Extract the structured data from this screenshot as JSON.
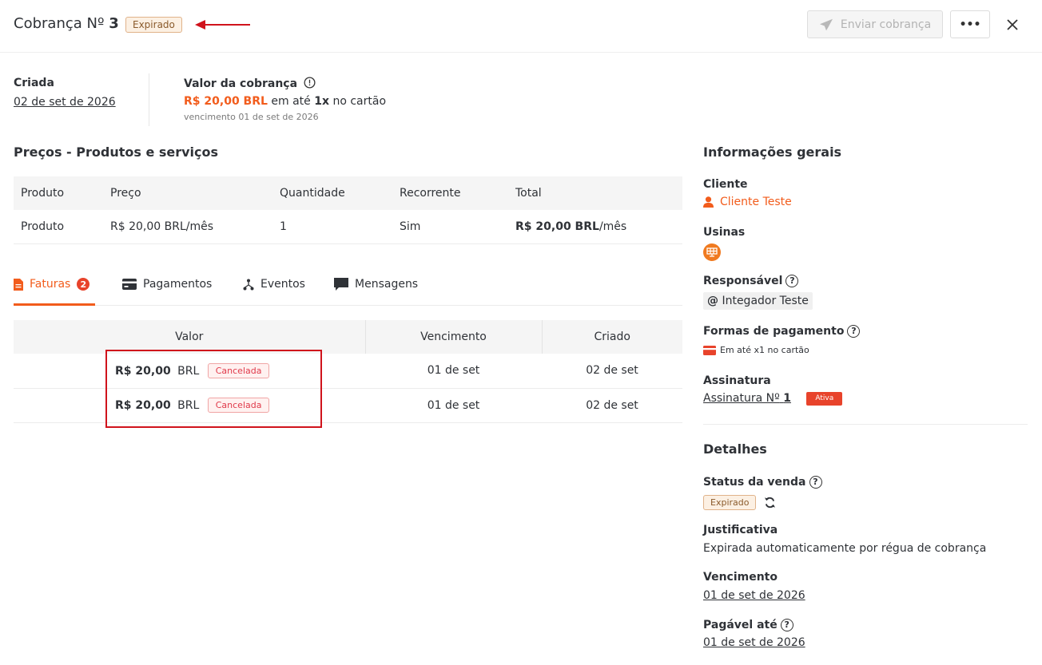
{
  "header": {
    "title_prefix": "Cobrança Nº",
    "title_number": "3",
    "status_badge": "Expirado",
    "send_button": "Enviar cobrança",
    "more_button": "•••",
    "annotation_arrow_color": "#d0131c"
  },
  "summary": {
    "created_label": "Criada",
    "created_date": "02 de set de 2026",
    "amount_label": "Valor da cobrança",
    "amount_value": "R$ 20,00 BRL",
    "amount_text_1": "em até",
    "amount_installments": "1x",
    "amount_text_2": "no cartão",
    "due_note": "vencimento 01 de set de 2026"
  },
  "prices": {
    "title": "Preços - Produtos e serviços",
    "columns": [
      "Produto",
      "Preço",
      "Quantidade",
      "Recorrente",
      "Total"
    ],
    "rows": [
      {
        "produto": "Produto",
        "preco": "R$ 20,00 BRL/mês",
        "quantidade": "1",
        "recorrente": "Sim",
        "total_bold": "R$ 20,00 BRL",
        "total_suffix": "/mês"
      }
    ]
  },
  "tabs": [
    {
      "label": "Faturas",
      "badge": "2",
      "active": true
    },
    {
      "label": "Pagamentos"
    },
    {
      "label": "Eventos"
    },
    {
      "label": "Mensagens"
    }
  ],
  "invoices": {
    "columns": [
      "Valor",
      "Vencimento",
      "Criado"
    ],
    "rows": [
      {
        "valor": "R$ 20,00",
        "currency": "BRL",
        "status": "Cancelada",
        "vencimento": "01 de set",
        "criado": "02 de set"
      },
      {
        "valor": "R$ 20,00",
        "currency": "BRL",
        "status": "Cancelada",
        "vencimento": "01 de set",
        "criado": "02 de set"
      }
    ]
  },
  "sidebar": {
    "general_title": "Informações gerais",
    "client_label": "Cliente",
    "client_name": "Cliente Teste",
    "plants_label": "Usinas",
    "responsible_label": "Responsável",
    "responsible_name": "Integador Teste",
    "payment_methods_label": "Formas de pagamento",
    "payment_method": "Em até x1 no cartão",
    "subscription_label": "Assinatura",
    "subscription_link": "Assinatura Nº",
    "subscription_number": "1",
    "subscription_status": "Ativa",
    "details_title": "Detalhes",
    "sale_status_label": "Status da venda",
    "sale_status": "Expirado",
    "justification_label": "Justificativa",
    "justification": "Expirada automaticamente por régua de cobrança",
    "due_label": "Vencimento",
    "due_date": "01 de set de 2026",
    "payable_label": "Pagável até",
    "payable_date": "01 de set de 2026"
  },
  "colors": {
    "accent": "#f25c1c",
    "danger": "#e8432b",
    "annotation": "#d0131c"
  }
}
